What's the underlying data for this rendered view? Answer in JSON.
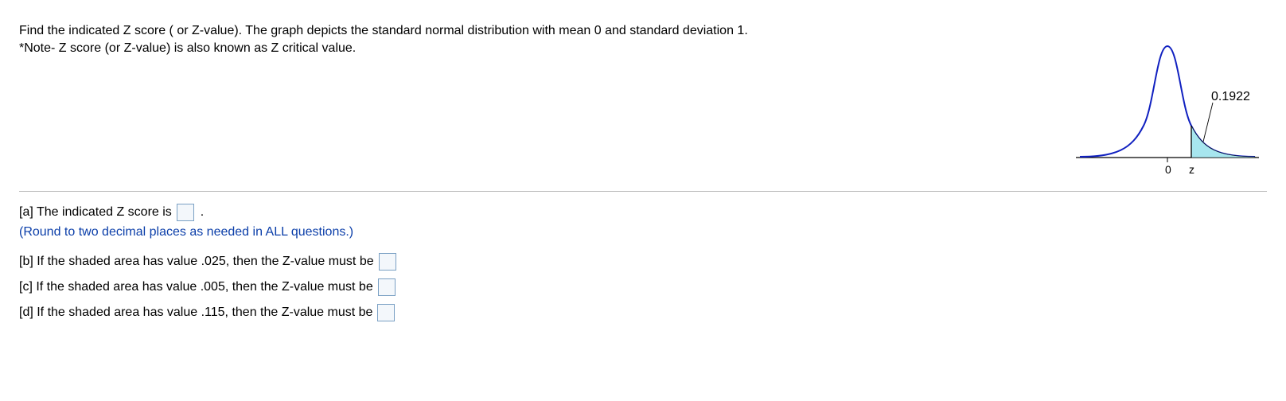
{
  "prompt": {
    "line1": "Find the indicated Z score ( or Z-value). The graph depicts the standard normal distribution with mean 0 and standard deviation 1.",
    "line2": "*Note- Z score (or Z-value) is also known as Z critical value."
  },
  "graph": {
    "area_label": "0.1922",
    "axis_zero": "0",
    "axis_z": "z"
  },
  "qa": {
    "a_pre": "[a] The indicated Z score is",
    "a_post": ".",
    "round_note": "(Round to two decimal places as needed in ALL questions.)",
    "b_text": "[b] If the shaded area has value .025, then the Z-value must be",
    "c_text": "[c] If the shaded area has value .005, then the Z-value must be",
    "d_text": "[d] If the shaded area has value .115, then the Z-value must be"
  },
  "chart_data": {
    "type": "area",
    "title": "Standard normal distribution",
    "mean": 0,
    "sd": 1,
    "shaded_region": {
      "from": "z",
      "to": "+inf",
      "area": 0.1922
    },
    "axis_ticks": [
      "0",
      "z"
    ]
  }
}
